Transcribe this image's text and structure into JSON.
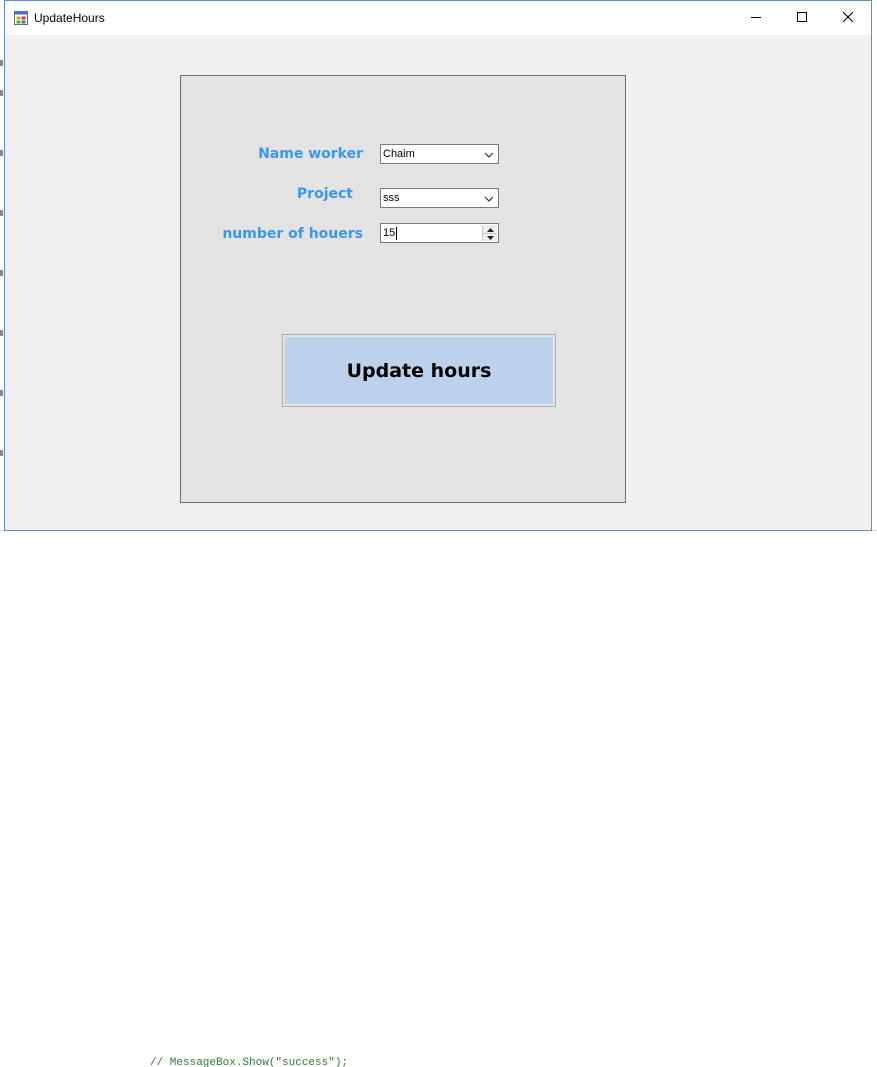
{
  "window": {
    "title": "UpdateHours"
  },
  "form": {
    "name_label": "Name worker",
    "project_label": "Project",
    "hours_label": "number of houers",
    "name_value": "Chaim",
    "project_value": "sss",
    "hours_value": "15",
    "update_button": "Update hours"
  },
  "background": {
    "code_snippet": "// MessageBox.Show(\"success\");"
  },
  "colors": {
    "label": "#3b96f0",
    "button_fill": "#bcd2ec",
    "panel": "#e3e3e3",
    "window_border": "#5c8fcf"
  },
  "icons": {
    "app": "app-form-icon",
    "minimize": "minimize-icon",
    "maximize": "maximize-icon",
    "close": "close-icon",
    "dropdown": "chevron-down-icon",
    "spin_up": "triangle-up-icon",
    "spin_down": "triangle-down-icon"
  }
}
